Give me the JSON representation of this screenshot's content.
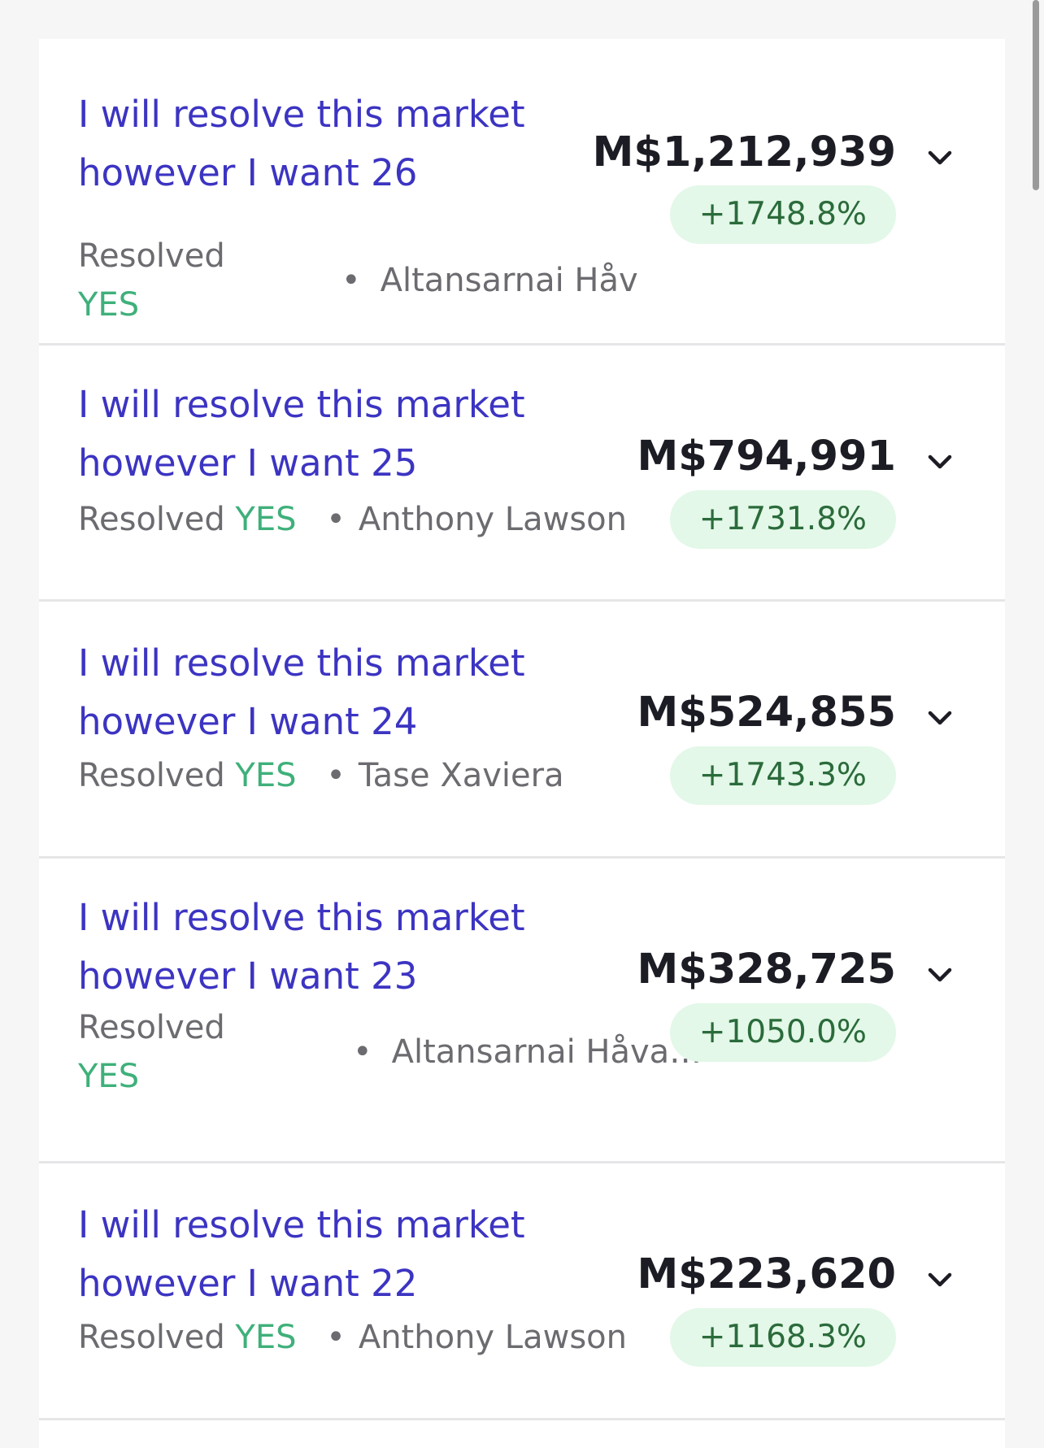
{
  "markets": [
    {
      "title": "I will resolve this market however I want 26",
      "status_label": "Resolved",
      "resolution": "YES",
      "separator": "•",
      "creator": "Altansarnai Håv",
      "amount": "M$1,212,939",
      "change": "+1748.8%"
    },
    {
      "title": "I will resolve this market however I want 25",
      "status_label": "Resolved",
      "resolution": "YES",
      "separator": "•",
      "creator": "Anthony Lawson",
      "amount": "M$794,991",
      "change": "+1731.8%"
    },
    {
      "title": "I will resolve this market however I want 24",
      "status_label": "Resolved",
      "resolution": "YES",
      "separator": "•",
      "creator": "Tase Xaviera",
      "amount": "M$524,855",
      "change": "+1743.3%"
    },
    {
      "title": "I will resolve this market however I want 23",
      "status_label": "Resolved",
      "resolution": "YES",
      "separator": "•",
      "creator": "Altansarnai Håva…",
      "amount": "M$328,725",
      "change": "+1050.0%"
    },
    {
      "title": "I will resolve this market however I want 22",
      "status_label": "Resolved",
      "resolution": "YES",
      "separator": "•",
      "creator": "Anthony Lawson",
      "amount": "M$223,620",
      "change": "+1168.3%"
    }
  ],
  "colors": {
    "title": "#3c34c2",
    "yes": "#3fb07a",
    "badge_bg": "#e3f8e8",
    "badge_text": "#2b6b3b"
  },
  "icons": {
    "expand": "chevron-down-icon"
  }
}
